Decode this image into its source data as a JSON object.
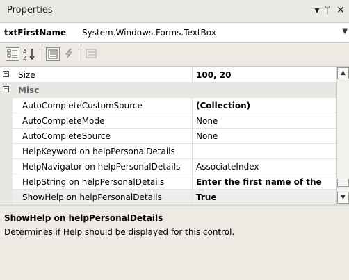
{
  "window": {
    "title": "Properties",
    "dropdown_icon": "dropdown-arrow-icon",
    "pin_icon": "pin-icon",
    "close_icon": "close-icon"
  },
  "object_selector": {
    "name": "txtFirstName",
    "type": "System.Windows.Forms.TextBox"
  },
  "toolbar": {
    "buttons": [
      "categorized-icon",
      "alphabetical-icon",
      "properties-icon",
      "events-icon",
      "property-pages-icon"
    ],
    "active": [
      "categorized-icon",
      "properties-icon"
    ]
  },
  "grid": {
    "rows": [
      {
        "kind": "collapsed",
        "name": "Size",
        "value": "100, 20",
        "bold": true
      },
      {
        "kind": "category",
        "name": "Misc",
        "value": ""
      },
      {
        "kind": "prop",
        "name": "AutoCompleteCustomSource",
        "value": "(Collection)",
        "bold": true
      },
      {
        "kind": "prop",
        "name": "AutoCompleteMode",
        "value": "None",
        "bold": false
      },
      {
        "kind": "prop",
        "name": "AutoCompleteSource",
        "value": "None",
        "bold": false
      },
      {
        "kind": "prop",
        "name": "HelpKeyword on helpPersonalDetails",
        "value": "",
        "bold": false
      },
      {
        "kind": "prop",
        "name": "HelpNavigator on helpPersonalDetails",
        "value": "AssociateIndex",
        "bold": false
      },
      {
        "kind": "prop",
        "name": "HelpString on helpPersonalDetails",
        "value": "Enter the first name of the",
        "bold": true
      },
      {
        "kind": "prop",
        "name": "ShowHelp on helpPersonalDetails",
        "value": "True",
        "bold": true,
        "selected": true
      }
    ]
  },
  "help": {
    "title": "ShowHelp on helpPersonalDetails",
    "description": "Determines if Help should be displayed for this control."
  }
}
